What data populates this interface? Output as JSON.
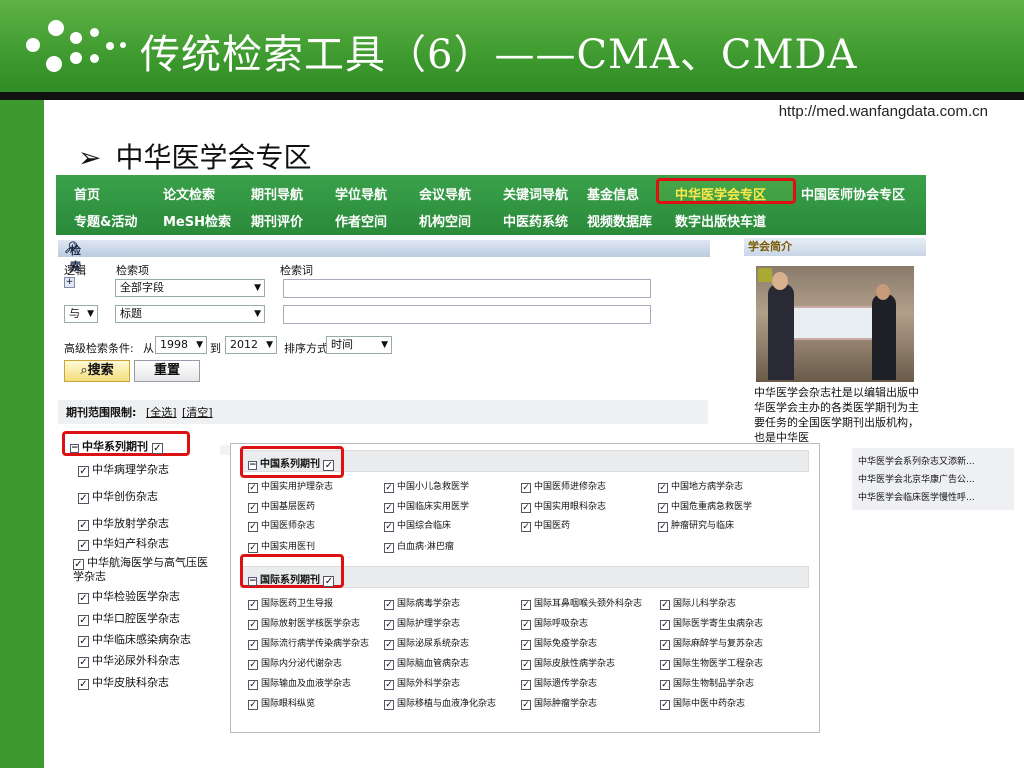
{
  "slide": {
    "title": "传统检索工具（6）——CMA、CMDA",
    "url": "http://med.wanfangdata.com.cn",
    "heading_arrow": "➢",
    "heading": "中华医学会专区"
  },
  "nav": {
    "row1": [
      "首页",
      "论文检索",
      "期刊导航",
      "学位导航",
      "会议导航",
      "关键词导航",
      "基金信息",
      "中华医学会专区",
      "中国医师协会专区"
    ],
    "row2": [
      "专题&活动",
      "MeSH检索",
      "期刊评价",
      "作者空间",
      "机构空间",
      "中医药系统",
      "视频数据库",
      "数字出版快车道"
    ],
    "active": "中华医学会专区"
  },
  "search": {
    "header": "检索",
    "col_logic": "逻辑",
    "col_field": "检索项",
    "col_term": "检索词",
    "row1_field": "全部字段",
    "row2_logic": "与",
    "row2_field": "标题",
    "advanced_label": "高级检索条件:",
    "from_label": "从",
    "from_year": "1998",
    "to_label": "到",
    "to_year": "2012",
    "sort_label": "排序方式",
    "sort_value": "时间",
    "search_button": "搜索",
    "reset_button": "重置",
    "range_label": "期刊范围限制:",
    "select_all": "[全选]",
    "clear": "[清空]"
  },
  "sidebar": {
    "header": "学会简介",
    "intro": "中华医学会杂志社是以编辑出版中华医学会主办的各类医学期刊为主要任务的全国医学期刊出版机构，也是中华医",
    "news": [
      "中华医学会系列杂志又添新...",
      "中华医学会北京华康广告公...",
      "中华医学会临床医学慢性呼..."
    ]
  },
  "left_list": {
    "category": "中华系列期刊",
    "journals": [
      "中华病理学杂志",
      "中华创伤杂志",
      "中华放射学杂志",
      "中华妇产科杂志",
      "中华航海医学与高气压医学杂志",
      "中华检验医学杂志",
      "中华口腔医学杂志",
      "中华临床感染病杂志",
      "中华泌尿外科杂志",
      "中华皮肤科杂志"
    ]
  },
  "overlay": {
    "china_header": "中国系列期刊",
    "china_journals": [
      [
        "中国实用护理杂志",
        "中国小儿急救医学",
        "中国医师进修杂志",
        "中国地方病学杂志"
      ],
      [
        "中国基层医药",
        "中国临床实用医学",
        "中国实用眼科杂志",
        "中国危重病急救医学"
      ],
      [
        "中国医师杂志",
        "中国综合临床",
        "中国医药",
        "肿瘤研究与临床"
      ],
      [
        "中国实用医刊",
        "白血病·淋巴瘤"
      ]
    ],
    "intl_header": "国际系列期刊",
    "intl_journals": [
      [
        "国际医药卫生导报",
        "国际病毒学杂志",
        "国际耳鼻咽喉头颈外科杂志",
        "国际儿科学杂志"
      ],
      [
        "国际放射医学核医学杂志",
        "国际护理学杂志",
        "国际呼吸杂志",
        "国际医学寄生虫病杂志"
      ],
      [
        "国际流行病学传染病学杂志",
        "国际泌尿系统杂志",
        "国际免疫学杂志",
        "国际麻醉学与复苏杂志"
      ],
      [
        "国际内分泌代谢杂志",
        "国际脑血管病杂志",
        "国际皮肤性病学杂志",
        "国际生物医学工程杂志"
      ],
      [
        "国际输血及血液学杂志",
        "国际外科学杂志",
        "国际遗传学杂志",
        "国际生物制品学杂志"
      ],
      [
        "国际眼科纵览",
        "国际移植与血液净化杂志",
        "国际肿瘤学杂志",
        "国际中医中药杂志"
      ]
    ]
  },
  "colors": {
    "green": "#3e9a2f",
    "highlight_red": "#dd1111",
    "nav_green": "#2a8a3a"
  }
}
